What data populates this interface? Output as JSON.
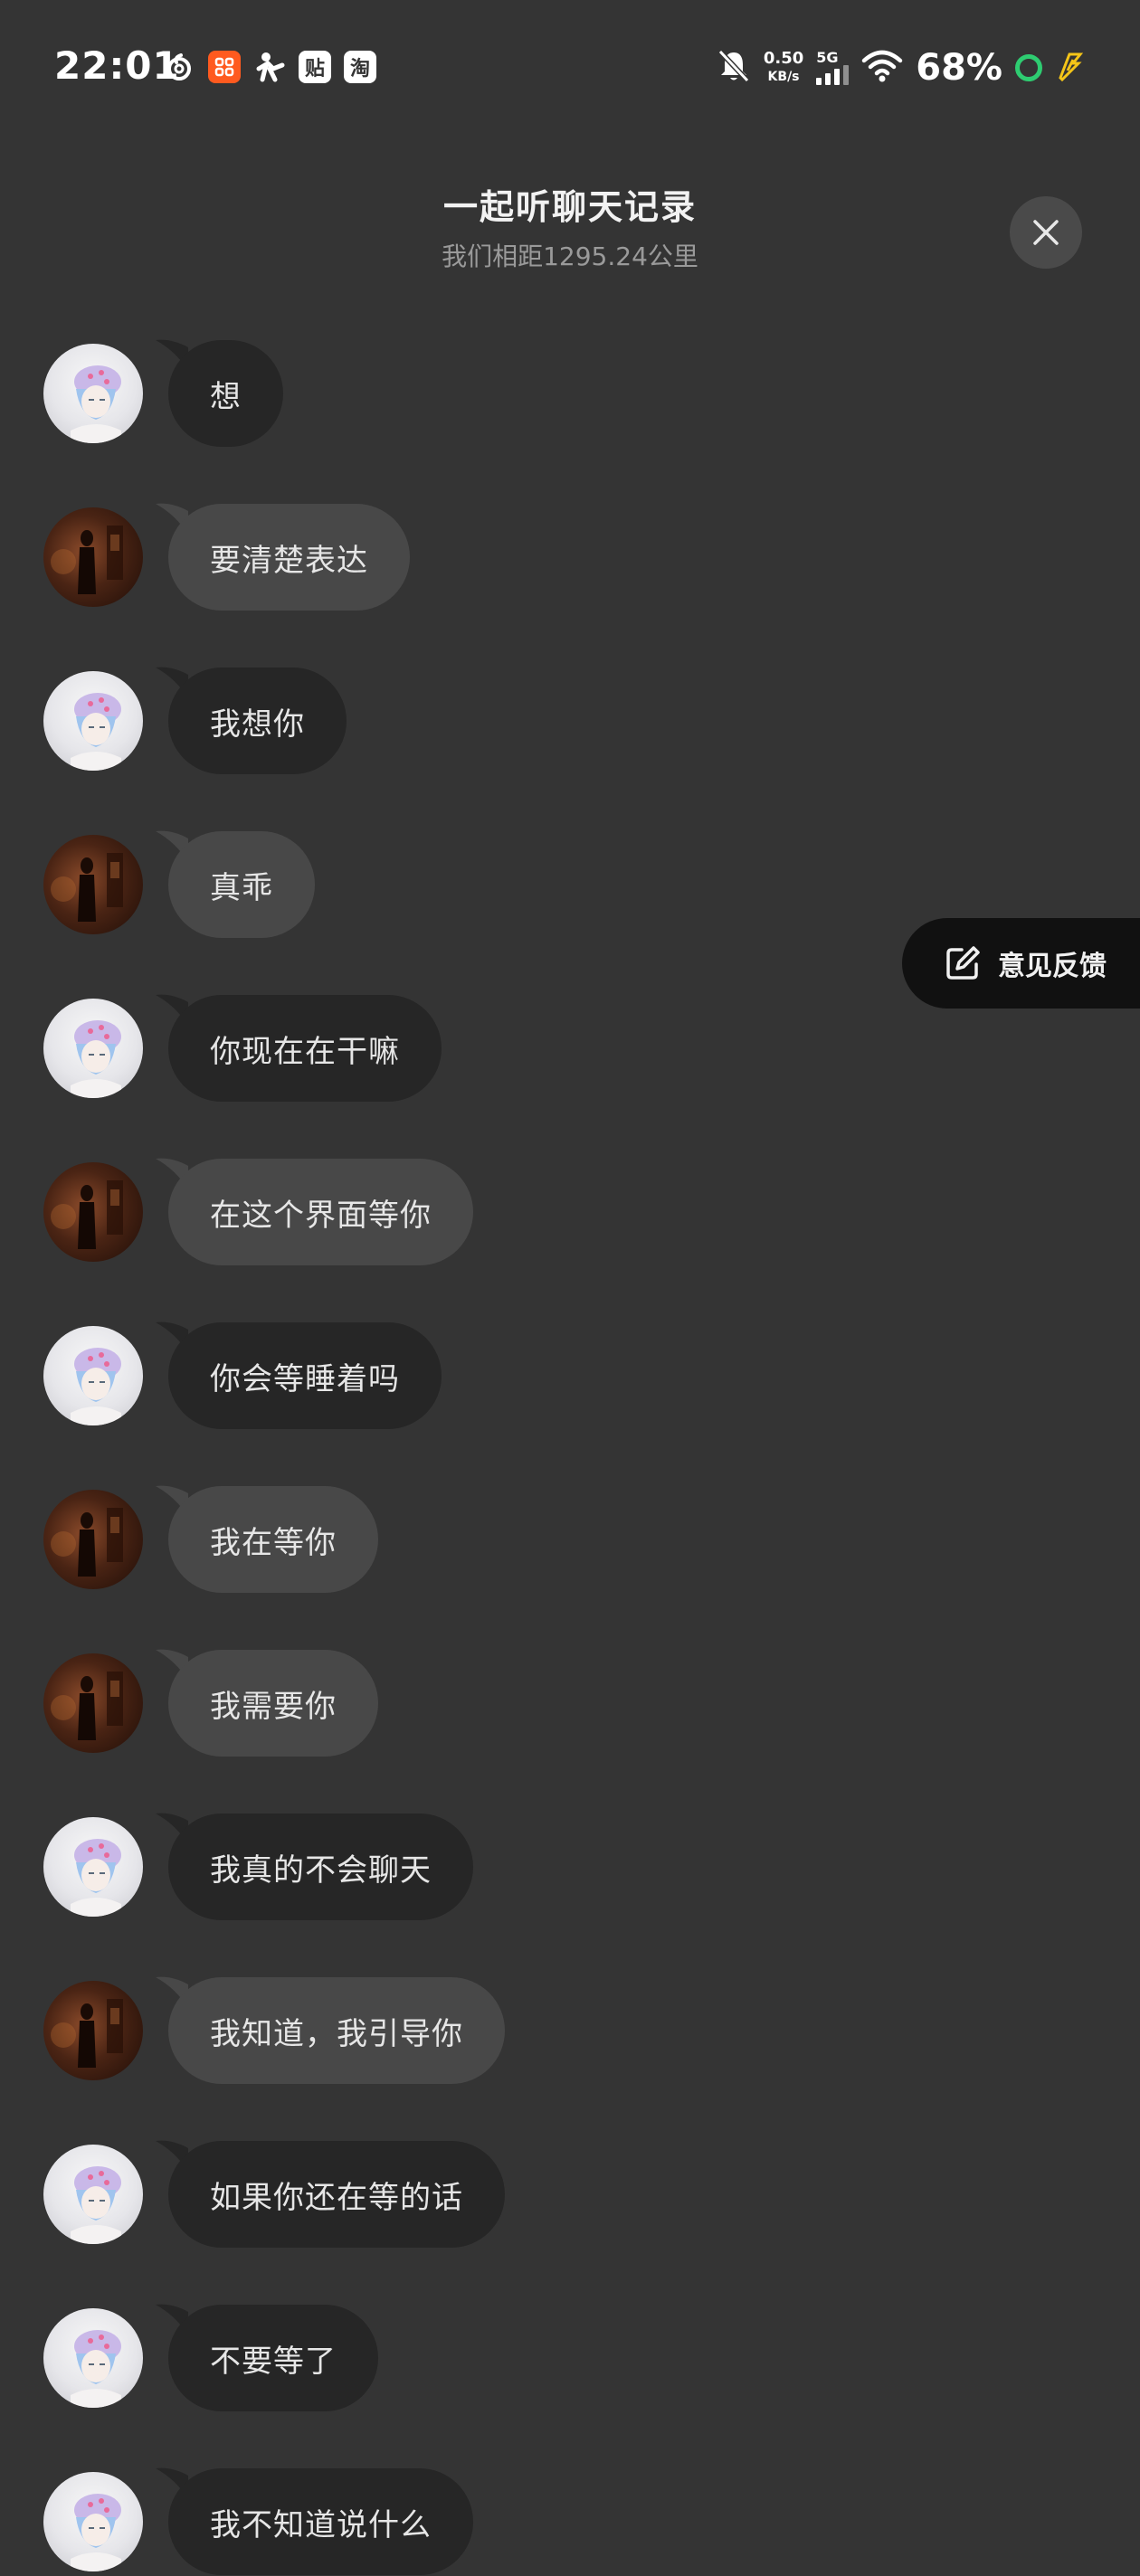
{
  "status_bar": {
    "time": "22:01",
    "speed_value": "0.50",
    "speed_unit": "KB/s",
    "network": "5G",
    "battery": "68%",
    "apps": {
      "orange": "",
      "tieba": "贴",
      "taobao": "淘"
    }
  },
  "header": {
    "title": "一起听聊天记录",
    "subtitle": "我们相距1295.24公里",
    "close_icon": "close-icon"
  },
  "feedback": {
    "label": "意见反馈",
    "icon": "edit-icon"
  },
  "colors": {
    "background": "#343434",
    "bubble_dark": "#262626",
    "bubble_light": "#484848",
    "battery_ring": "#2ecc71",
    "charging": "#f5c518"
  },
  "messages": [
    {
      "sender": "anime",
      "text": "想"
    },
    {
      "sender": "dark",
      "text": "要清楚表达"
    },
    {
      "sender": "anime",
      "text": "我想你"
    },
    {
      "sender": "dark",
      "text": "真乖"
    },
    {
      "sender": "anime",
      "text": "你现在在干嘛"
    },
    {
      "sender": "dark",
      "text": "在这个界面等你"
    },
    {
      "sender": "anime",
      "text": "你会等睡着吗"
    },
    {
      "sender": "dark",
      "text": "我在等你"
    },
    {
      "sender": "dark",
      "text": "我需要你"
    },
    {
      "sender": "anime",
      "text": "我真的不会聊天"
    },
    {
      "sender": "dark",
      "text": "我知道，我引导你"
    },
    {
      "sender": "anime",
      "text": "如果你还在等的话"
    },
    {
      "sender": "anime",
      "text": "不要等了"
    },
    {
      "sender": "anime",
      "text": "我不知道说什么"
    }
  ]
}
